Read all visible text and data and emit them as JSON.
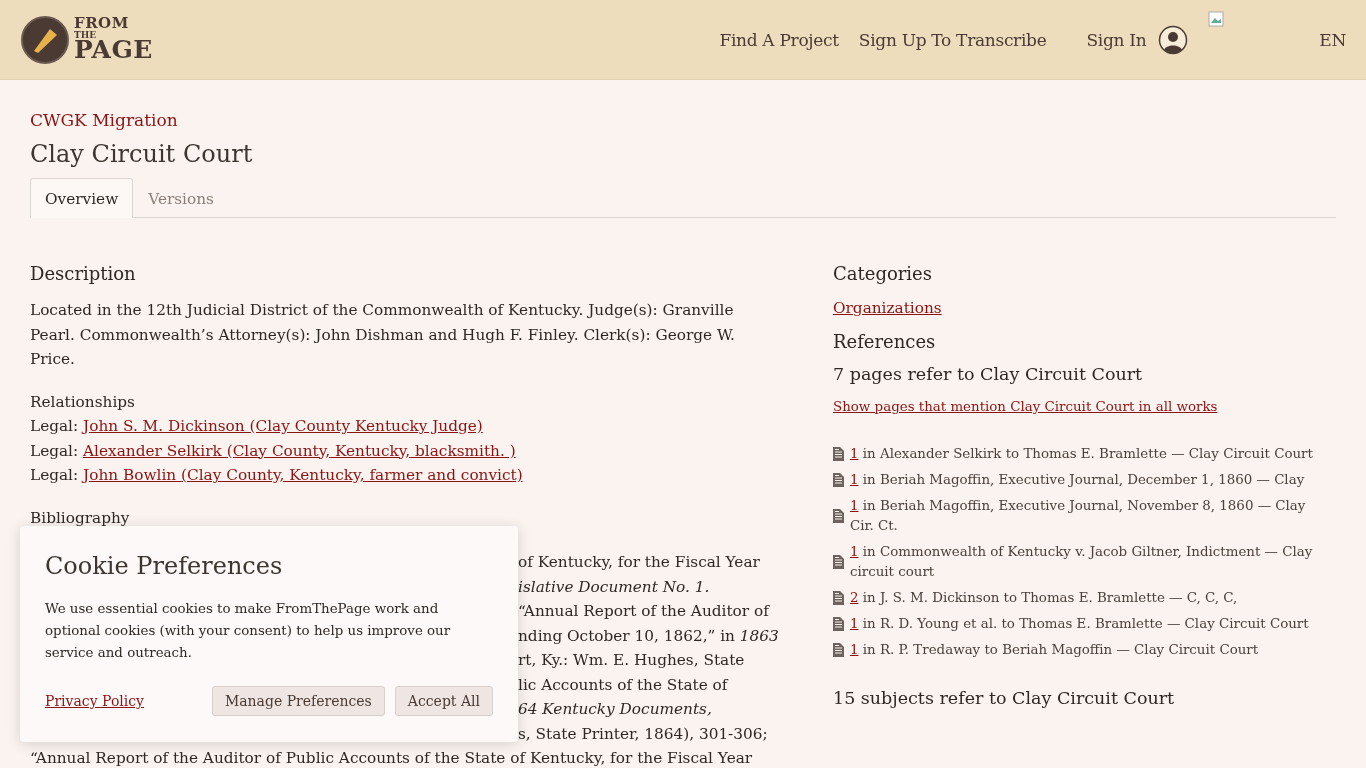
{
  "header": {
    "logo": {
      "top": "FROM",
      "middle": "THE",
      "bottom": "PAGE"
    },
    "nav": [
      "Find A Project",
      "Sign Up To Transcribe"
    ],
    "sign_in": "Sign In",
    "language": "EN"
  },
  "breadcrumb": "CWGK Migration",
  "title": "Clay Circuit Court",
  "tabs": [
    {
      "label": "Overview",
      "selected": true
    },
    {
      "label": "Versions",
      "selected": false
    }
  ],
  "description": {
    "heading": "Description",
    "text": "Located in the 12th Judicial District of the Commonwealth of Kentucky. Judge(s): Granville Pearl. Commonwealth’s Attorney(s): John Dishman and Hugh F. Finley. Clerk(s): George W. Price."
  },
  "relationships": {
    "heading": "Relationships",
    "items": [
      {
        "type": "Legal:",
        "link": "John S. M. Dickinson (Clay County Kentucky Judge)"
      },
      {
        "type": "Legal:",
        "link": "Alexander Selkirk (Clay County, Kentucky, blacksmith. )"
      },
      {
        "type": "Legal:",
        "link": "John Bowlin (Clay County, Kentucky, farmer and convict)"
      }
    ]
  },
  "bibliography": {
    "heading": "Bibliography",
    "lines": [
      "of Kentucky, for the Fiscal Year",
      "*islative Document No. 1.*",
      "“Annual Report of the Auditor of",
      "nding October 10, 1862,” in *1863*",
      "rt, Ky.: Wm. E. Hughes, State",
      "lic Accounts of the State of",
      "*64 Kentucky Documents,*",
      "s, State Printer, 1864), 301-306;",
      "“Annual Report of the Auditor of Public Accounts of the State of Kentucky, for the Fiscal Year"
    ]
  },
  "categories": {
    "heading": "Categories",
    "items": [
      "Organizations"
    ]
  },
  "references": {
    "heading": "References",
    "count_text": "7 pages refer to Clay Circuit Court",
    "show_link": "Show pages that mention Clay Circuit Court in all works",
    "items": [
      {
        "count": "1",
        "text": "in Alexander Selkirk to Thomas E. Bramlette — Clay Circuit Court"
      },
      {
        "count": "1",
        "text": "in Beriah Magoffin, Executive Journal, December 1, 1860 — Clay"
      },
      {
        "count": "1",
        "text": "in Beriah Magoffin, Executive Journal, November 8, 1860 — Clay Cir. Ct."
      },
      {
        "count": "1",
        "text": "in Commonwealth of Kentucky v. Jacob Giltner, Indictment — Clay circuit court"
      },
      {
        "count": "2",
        "text": "in J. S. M. Dickinson to Thomas E. Bramlette — C, C, C,"
      },
      {
        "count": "1",
        "text": "in R. D. Young et al. to Thomas E. Bramlette — Clay Circuit Court"
      },
      {
        "count": "1",
        "text": "in R. P. Tredaway to Beriah Magoffin — Clay Circuit Court"
      }
    ],
    "subjects_text": "15 subjects refer to Clay Circuit Court"
  },
  "cookie_dialog": {
    "title": "Cookie Preferences",
    "text": "We use essential cookies to make FromThePage work and optional cookies (with your consent) to help us improve our service and outreach.",
    "privacy_link": "Privacy Policy",
    "buttons": [
      "Manage Preferences",
      "Accept All"
    ]
  }
}
